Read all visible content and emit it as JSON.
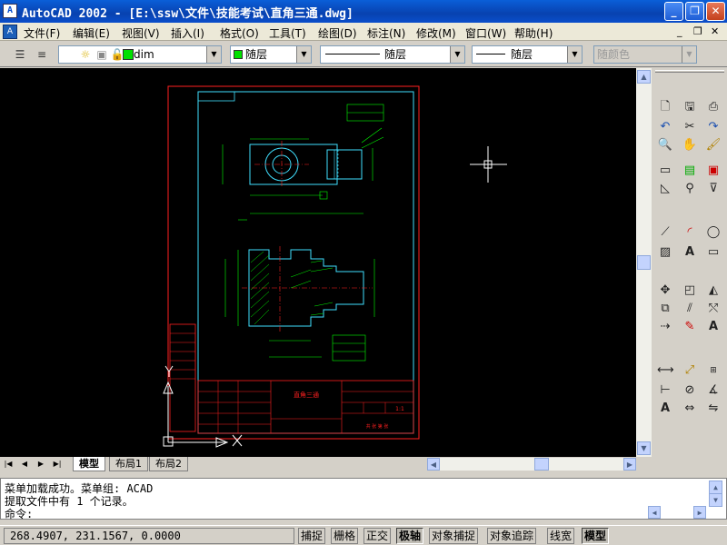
{
  "window": {
    "title": "AutoCAD 2002 - [E:\\ssw\\文件\\技能考试\\直角三通.dwg]",
    "controls": {
      "minimize": "_",
      "maximize": "❐",
      "close": "✕"
    }
  },
  "menubar": {
    "items": [
      "文件(F)",
      "编辑(E)",
      "视图(V)",
      "插入(I)",
      "格式(O)",
      "工具(T)",
      "绘图(D)",
      "标注(N)",
      "修改(M)",
      "窗口(W)",
      "帮助(H)"
    ],
    "mdi_controls": {
      "minimize": "_",
      "restore": "❐",
      "close": "✕"
    }
  },
  "toolbar": {
    "layer_combo": {
      "value": "dim"
    },
    "color_combo": {
      "value": "随层",
      "swatch_color": "#00e000"
    },
    "linetype_combo": {
      "value": "随层"
    },
    "lineweight_combo": {
      "value": "随层"
    },
    "plotstyle_combo": {
      "value": "随颜色"
    }
  },
  "drawing": {
    "background": "#000000",
    "frame_color": "#ff2020",
    "border_color": "#40e0ff",
    "dim_color": "#00ff00",
    "part_color": "#40e0ff",
    "hatch_color": "#00ff00",
    "title_block": {
      "part_name": "直角三通",
      "scale": "1:1",
      "sheet": "共 张 第 张"
    }
  },
  "tabs": {
    "items": [
      "模型",
      "布局1",
      "布局2"
    ],
    "active": "模型"
  },
  "command": {
    "lines": [
      "菜单加载成功。菜单组: ACAD",
      "提取文件中有 1 个记录。",
      "命令:"
    ]
  },
  "status": {
    "coordinates": "268.4907, 231.1567, 0.0000",
    "buttons": [
      {
        "label": "捕捉",
        "on": false
      },
      {
        "label": "栅格",
        "on": false
      },
      {
        "label": "正交",
        "on": false
      },
      {
        "label": "极轴",
        "on": true
      },
      {
        "label": "对象捕捉",
        "on": false
      },
      {
        "label": "对象追踪",
        "on": false
      },
      {
        "label": "线宽",
        "on": false
      },
      {
        "label": "模型",
        "on": true
      }
    ]
  }
}
